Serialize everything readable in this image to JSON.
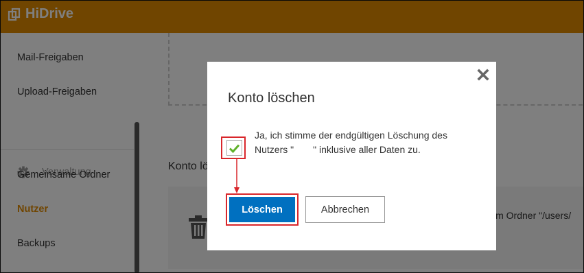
{
  "app": {
    "name": "HiDrive"
  },
  "sidebar": {
    "items": [
      {
        "label": "Mail-Freigaben"
      },
      {
        "label": "Upload-Freigaben"
      },
      {
        "label": "Gemeinsame Ordner"
      },
      {
        "label": "Nutzer"
      },
      {
        "label": "Backups"
      }
    ],
    "section_label": "Verwaltung"
  },
  "main": {
    "heading": "Konto lö",
    "panel_text": "im Ordner \"/users/"
  },
  "dialog": {
    "title": "Konto löschen",
    "consent_text": "Ja, ich stimme der endgültigen Löschung des Nutzers \"  \" inklusive aller Daten zu.",
    "checked": true,
    "delete_label": "Löschen",
    "cancel_label": "Abbrechen"
  },
  "colors": {
    "brand": "#e08a00",
    "primary_button": "#0070c0",
    "highlight": "#d9262b",
    "check": "#5fb12a"
  }
}
